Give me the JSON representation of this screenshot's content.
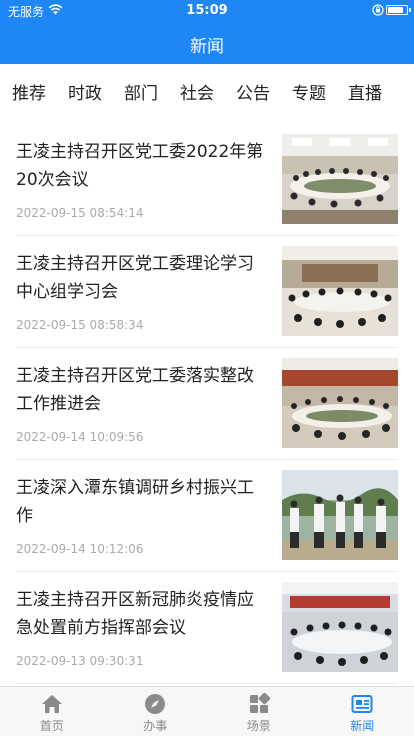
{
  "status": {
    "carrier": "无服务",
    "time": "15:09",
    "battery_level": 0.85
  },
  "header": {
    "title": "新闻"
  },
  "tabs": [
    {
      "label": "推荐",
      "active": true
    },
    {
      "label": "时政"
    },
    {
      "label": "部门"
    },
    {
      "label": "社会"
    },
    {
      "label": "公告"
    },
    {
      "label": "专题"
    },
    {
      "label": "直播"
    }
  ],
  "articles": [
    {
      "title": "王凌主持召开区党工委2022年第20次会议",
      "date": "2022-09-15 08:54:14",
      "thumb": "meeting-photo"
    },
    {
      "title": "王凌主持召开区党工委理论学习中心组学习会",
      "date": "2022-09-15 08:58:34",
      "thumb": "meeting-photo"
    },
    {
      "title": "王凌主持召开区党工委落实整改工作推进会",
      "date": "2022-09-14 10:09:56",
      "thumb": "meeting-photo"
    },
    {
      "title": "王凌深入潭东镇调研乡村振兴工作",
      "date": "2022-09-14 10:12:06",
      "thumb": "outdoor-visit-photo"
    },
    {
      "title": "王凌主持召开区新冠肺炎疫情应急处置前方指挥部会议",
      "date": "2022-09-13 09:30:31",
      "thumb": "meeting-photo"
    }
  ],
  "tabbar": [
    {
      "label": "首页",
      "icon": "home-icon"
    },
    {
      "label": "办事",
      "icon": "compass-icon"
    },
    {
      "label": "场景",
      "icon": "grid-icon"
    },
    {
      "label": "新闻",
      "icon": "news-icon",
      "active": true
    }
  ],
  "colors": {
    "primary": "#1f86f5",
    "tab_active": "#4a9b88",
    "date": "#aaaaaa"
  }
}
